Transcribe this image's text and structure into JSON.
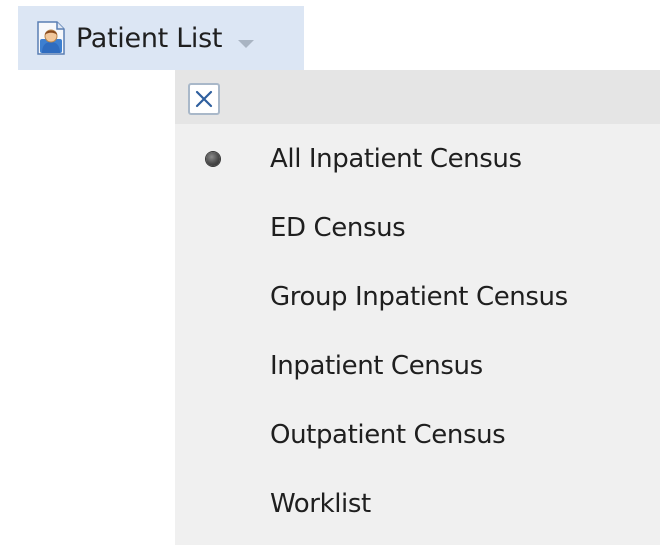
{
  "menu_button": {
    "label": "Patient List",
    "icon": "patient-list-icon",
    "dropdown_icon": "chevron-down-icon"
  },
  "dropdown": {
    "close_icon": "close-icon",
    "items": [
      {
        "label": "All Inpatient Census",
        "selected": true
      },
      {
        "label": "ED Census",
        "selected": false
      },
      {
        "label": "Group Inpatient Census",
        "selected": false
      },
      {
        "label": "Inpatient Census",
        "selected": false
      },
      {
        "label": "Outpatient Census",
        "selected": false
      },
      {
        "label": "Worklist",
        "selected": false
      }
    ]
  },
  "colors": {
    "button_bg": "#dce6f4",
    "dropdown_bg": "#f0f0f0",
    "header_bg": "#e5e5e5",
    "close_border": "#a9b8c9",
    "close_x": "#2e5f9e"
  }
}
